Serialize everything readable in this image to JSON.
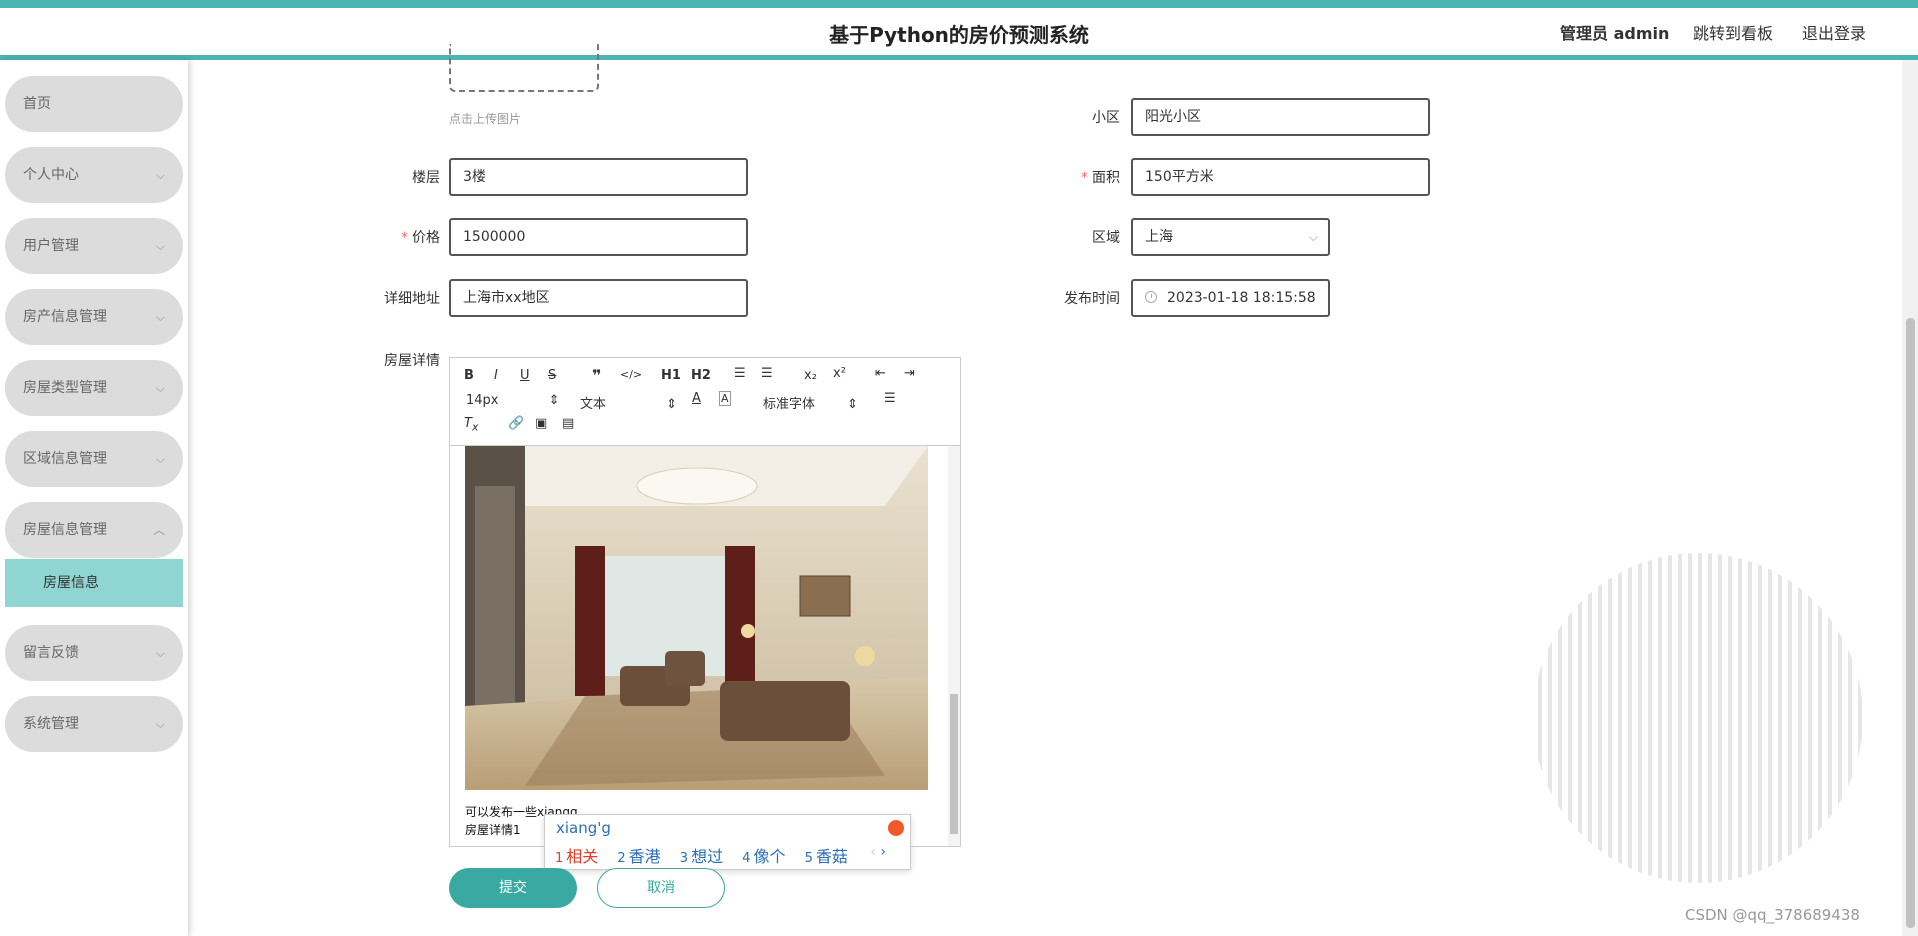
{
  "header": {
    "title": "基于Python的房价预测系统",
    "admin": "管理员 admin",
    "board": "跳转到看板",
    "logout": "退出登录"
  },
  "sidebar": {
    "items": [
      {
        "label": "首页"
      },
      {
        "label": "个人中心"
      },
      {
        "label": "用户管理"
      },
      {
        "label": "房产信息管理"
      },
      {
        "label": "房屋类型管理"
      },
      {
        "label": "区域信息管理"
      },
      {
        "label": "房屋信息管理"
      },
      {
        "label": "留言反馈"
      },
      {
        "label": "系统管理"
      }
    ],
    "submenu": {
      "label": "房屋信息"
    }
  },
  "form": {
    "upload_hint": "点击上传图片",
    "community": {
      "label": "小区",
      "value": "阳光小区"
    },
    "floor": {
      "label": "楼层",
      "value": "3楼"
    },
    "area": {
      "label": "面积",
      "value": "150平方米"
    },
    "price": {
      "label": "价格",
      "value": "1500000"
    },
    "region": {
      "label": "区域",
      "value": "上海"
    },
    "address": {
      "label": "详细地址",
      "value": "上海市xx地区"
    },
    "publish_time": {
      "label": "发布时间",
      "value": "2023-01-18 18:15:58"
    },
    "details": {
      "label": "房屋详情"
    }
  },
  "editor": {
    "font_size": "14px",
    "paragraph": "文本",
    "font_family": "标准字体",
    "heading1": "H1",
    "heading2": "H2",
    "text_line1": "可以发布一些xiangg",
    "text_line2": "房屋详情1"
  },
  "ime": {
    "pinyin": "xiang'g",
    "candidates": [
      {
        "n": "1",
        "text": "相关"
      },
      {
        "n": "2",
        "text": "香港"
      },
      {
        "n": "3",
        "text": "想过"
      },
      {
        "n": "4",
        "text": "像个"
      },
      {
        "n": "5",
        "text": "香菇"
      }
    ]
  },
  "buttons": {
    "submit": "提交",
    "cancel": "取消"
  },
  "watermark": "CSDN @qq_378689438",
  "colors": {
    "accent": "#4ab5b1",
    "submenu_bg": "#8fd5d1",
    "required": "#f56c6c"
  }
}
